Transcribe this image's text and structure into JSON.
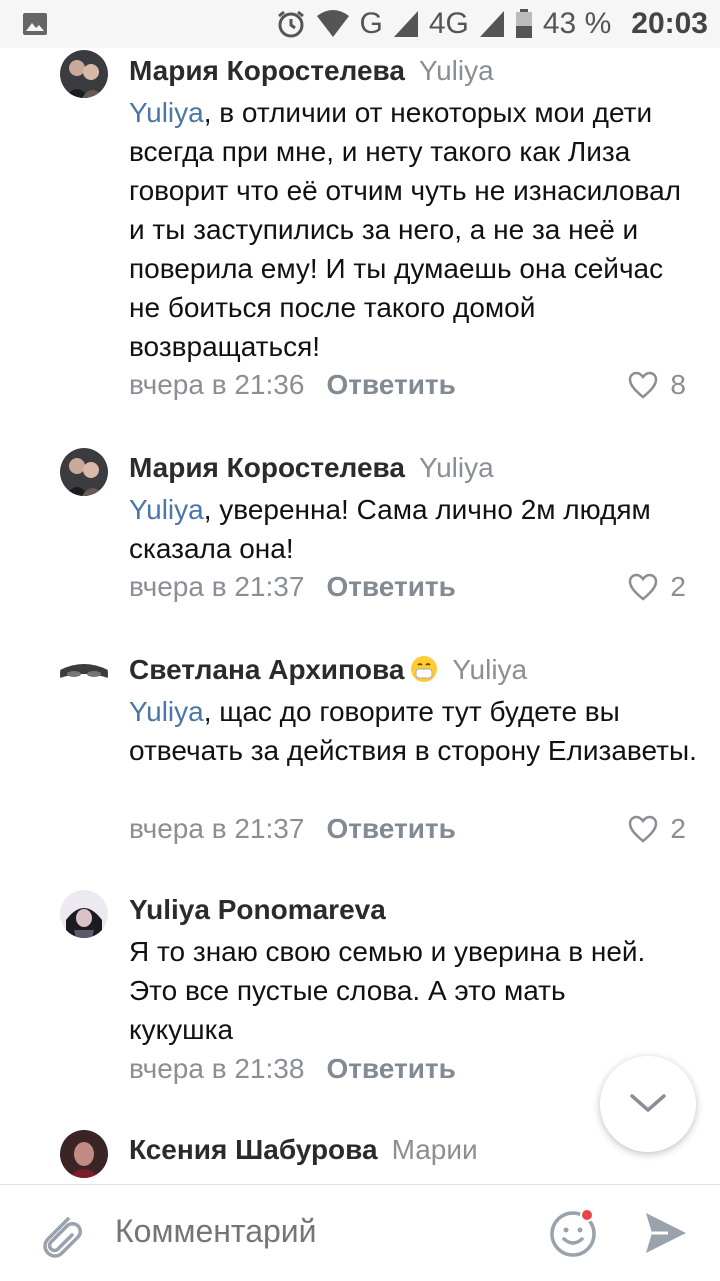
{
  "status_bar": {
    "network_g": "G",
    "network_4g": "4G",
    "battery": "43 %",
    "time": "20:03"
  },
  "comments": [
    {
      "author": "Мария Коростелева",
      "reply_to": "Yuliya",
      "mention": "Yuliya",
      "text": ", в отличии от некоторых мои дети всегда при мне, и нету такого как Лиза говорит что её отчим чуть не изнасиловал и ты заступились за него, а не за неё и поверила ему! И ты думаешь она сейчас не боиться после такого домой возвращаться!",
      "time": "вчера в 21:36",
      "reply_label": "Ответить",
      "likes": "8"
    },
    {
      "author": "Мария Коростелева",
      "reply_to": "Yuliya",
      "mention": "Yuliya",
      "text": ", уверенна! Сама лично 2м людям сказала она!",
      "time": "вчера в 21:37",
      "reply_label": "Ответить",
      "likes": "2"
    },
    {
      "author": "Светлана Архипова",
      "reply_to": "Yuliya",
      "mention": "Yuliya",
      "text": ", щас до говорите тут будете вы отвечать за действия в сторону Елизаветы.",
      "time": "вчера в 21:37",
      "reply_label": "Ответить",
      "likes": "2"
    },
    {
      "author": "Yuliya Ponomareva",
      "text": "Я то знаю свою семью и уверина в ней. Это все пустые слова. А это мать кукушка",
      "time": "вчера в 21:38",
      "reply_label": "Ответить"
    },
    {
      "author": "Ксения Шабурова",
      "reply_to": "Марии"
    }
  ],
  "input": {
    "placeholder": "Комментарий"
  },
  "icons": {
    "attach": "paperclip-icon",
    "emoji": "smiley-icon",
    "send": "send-icon",
    "scroll_down": "chevron-down-icon"
  },
  "colors": {
    "link": "#4a76a8",
    "meta": "#8a8f96",
    "icon": "#99a2ad"
  }
}
